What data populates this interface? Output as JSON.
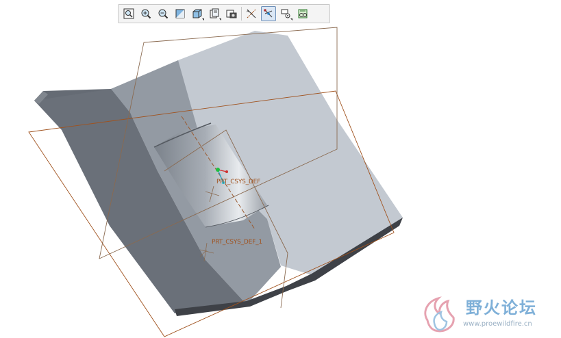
{
  "toolbar": {
    "buttons": [
      {
        "icon": "zoom-fit-icon"
      },
      {
        "icon": "zoom-in-icon"
      },
      {
        "icon": "zoom-out-icon"
      },
      {
        "icon": "repaint-icon"
      },
      {
        "icon": "display-style-icon"
      },
      {
        "icon": "saved-views-icon"
      },
      {
        "icon": "view-manager-icon"
      },
      {
        "icon": "datum-planes-icon"
      },
      {
        "icon": "datum-axes-icon",
        "active": true
      },
      {
        "icon": "datum-points-icon"
      },
      {
        "icon": "csys-display-icon"
      }
    ]
  },
  "model": {
    "labels": {
      "csys_primary": "PRT_CSYS_DEF",
      "csys_secondary": "PRT_CSYS_DEF_1"
    },
    "colors": {
      "datum_plane": "#a0521e",
      "face_light": "#c3c9d1",
      "face_mid": "#939aa3",
      "face_dark": "#6a7079",
      "edge_dark": "#3e4147"
    }
  },
  "watermark": {
    "title": "野火论坛",
    "url": "www.proewildfire.cn"
  }
}
